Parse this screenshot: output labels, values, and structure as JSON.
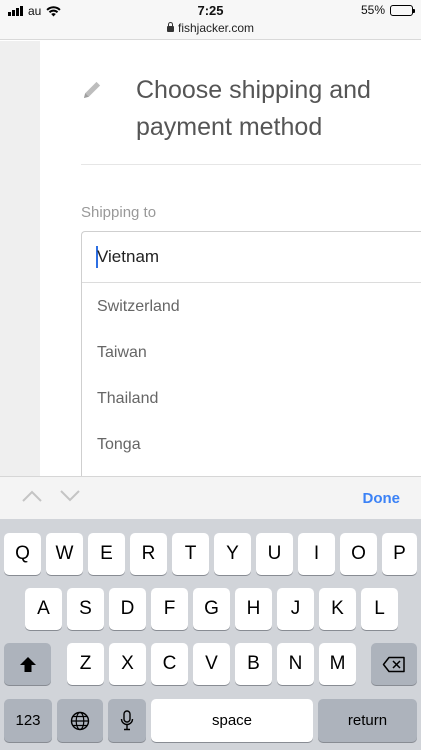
{
  "status_bar": {
    "carrier": "au",
    "time": "7:25",
    "url": "fishjacker.com",
    "battery": "55%",
    "battery_level": 0.55
  },
  "page": {
    "title": "Choose shipping and payment method",
    "shipping_label": "Shipping to",
    "shipping_value": "Vietnam",
    "options": [
      "Switzerland",
      "Taiwan",
      "Thailand",
      "Tonga"
    ]
  },
  "accessory_bar": {
    "done_label": "Done"
  },
  "keyboard": {
    "row1": [
      "Q",
      "W",
      "E",
      "R",
      "T",
      "Y",
      "U",
      "I",
      "O",
      "P"
    ],
    "row2": [
      "A",
      "S",
      "D",
      "F",
      "G",
      "H",
      "J",
      "K",
      "L"
    ],
    "row3": [
      "Z",
      "X",
      "C",
      "V",
      "B",
      "N",
      "M"
    ],
    "numbers_label": "123",
    "space_label": "space",
    "return_label": "return"
  }
}
